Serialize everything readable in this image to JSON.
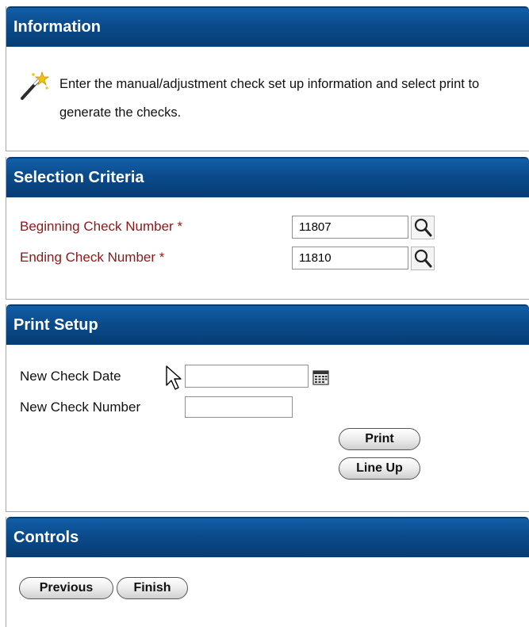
{
  "information": {
    "title": "Information",
    "message": "Enter the manual/adjustment check set up information and select print to generate the checks."
  },
  "selection_criteria": {
    "title": "Selection Criteria",
    "beginning_label": "Beginning Check Number *",
    "beginning_value": "11807",
    "ending_label": "Ending Check Number *",
    "ending_value": "11810"
  },
  "print_setup": {
    "title": "Print Setup",
    "new_check_date_label": "New Check Date",
    "new_check_date_value": "",
    "new_check_number_label": "New Check Number",
    "new_check_number_value": "",
    "print_button": "Print",
    "lineup_button": "Line Up"
  },
  "controls": {
    "title": "Controls",
    "previous_button": "Previous",
    "finish_button": "Finish"
  },
  "colors": {
    "header_blue": "#0b4b8b",
    "required_label": "#8b1818"
  },
  "icons": [
    "magic-wand-icon",
    "magnifier-icon",
    "calendar-icon",
    "mouse-pointer-icon"
  ]
}
